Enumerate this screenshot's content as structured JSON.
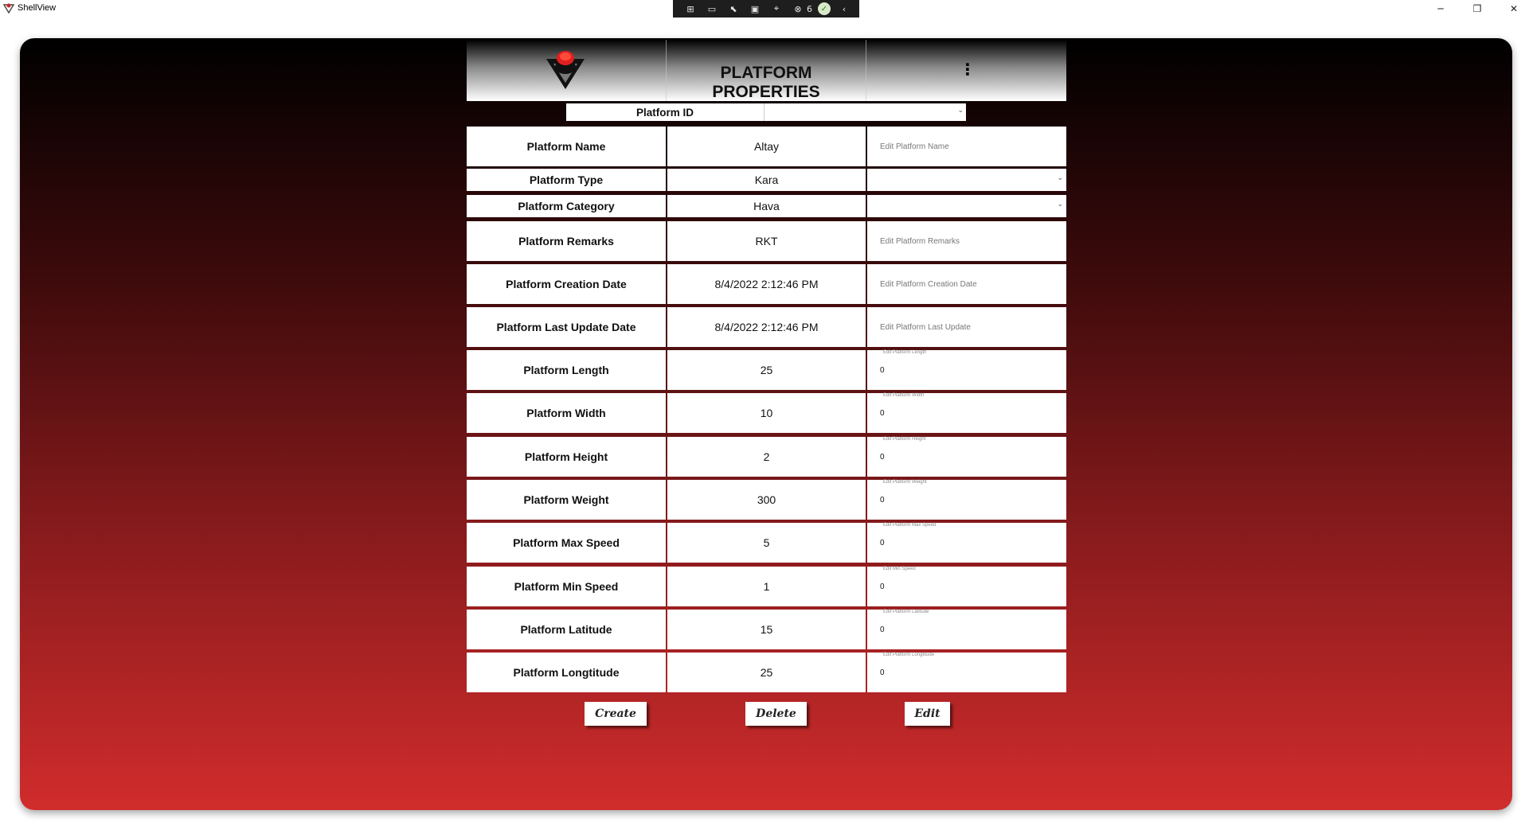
{
  "window": {
    "title": "ShellView",
    "controls": {
      "minimize": "─",
      "restore": "❐",
      "close": "✕"
    }
  },
  "devbar": {
    "icons": [
      "live-visual-tree-icon",
      "record-icon",
      "select-element-icon",
      "display-layout-icon",
      "track-focus-icon",
      "binding-failures-icon",
      "hot-reload-icon",
      "collapse-icon"
    ],
    "binding_failures_count": "6"
  },
  "header": {
    "title": "PLATFORM PROPERTIES"
  },
  "platform_id": {
    "label": "Platform ID",
    "selected": ""
  },
  "rows": [
    {
      "label": "Platform Name",
      "value": "Altay",
      "editor": "text",
      "placeholder": "Edit Platform Name",
      "input_value": ""
    },
    {
      "label": "Platform Type",
      "value": "Kara",
      "editor": "dropdown",
      "placeholder": "",
      "input_value": ""
    },
    {
      "label": "Platform Category",
      "value": "Hava",
      "editor": "dropdown",
      "placeholder": "",
      "input_value": ""
    },
    {
      "label": "Platform Remarks",
      "value": "RKT",
      "editor": "text",
      "placeholder": "Edit Platform Remarks",
      "input_value": ""
    },
    {
      "label": "Platform Creation Date",
      "value": "8/4/2022 2:12:46 PM",
      "editor": "text",
      "placeholder": "Edit Platform Creation Date",
      "input_value": ""
    },
    {
      "label": "Platform Last Update Date",
      "value": "8/4/2022 2:12:46 PM",
      "editor": "text",
      "placeholder": "Edit Platform Last Update",
      "input_value": ""
    },
    {
      "label": "Platform Length",
      "value": "25",
      "editor": "number",
      "placeholder": "Edit Platform Length",
      "input_value": "0"
    },
    {
      "label": "Platform Width",
      "value": "10",
      "editor": "number",
      "placeholder": "Edit Platform Width",
      "input_value": "0"
    },
    {
      "label": "Platform Height",
      "value": "2",
      "editor": "number",
      "placeholder": "Edit Platform Height",
      "input_value": "0"
    },
    {
      "label": "Platform Weight",
      "value": "300",
      "editor": "number",
      "placeholder": "Edit Platform Weight",
      "input_value": "0"
    },
    {
      "label": "Platform Max Speed",
      "value": "5",
      "editor": "number",
      "placeholder": "Edit Platform Max Speed",
      "input_value": "0"
    },
    {
      "label": "Platform Min Speed",
      "value": "1",
      "editor": "number",
      "placeholder": "Edit Min Speed",
      "input_value": "0"
    },
    {
      "label": "Platform Latitude",
      "value": "15",
      "editor": "number",
      "placeholder": "Edit Platform Latitude",
      "input_value": "0"
    },
    {
      "label": "Platform Longtitude",
      "value": "25",
      "editor": "number",
      "placeholder": "Edit Platform Longtitude",
      "input_value": "0"
    }
  ],
  "actions": {
    "create": "Create",
    "delete": "Delete",
    "edit": "Edit"
  },
  "colors": {
    "gradient_top": "#000000",
    "gradient_bottom": "#d12c2c",
    "accent": "#e02020"
  }
}
